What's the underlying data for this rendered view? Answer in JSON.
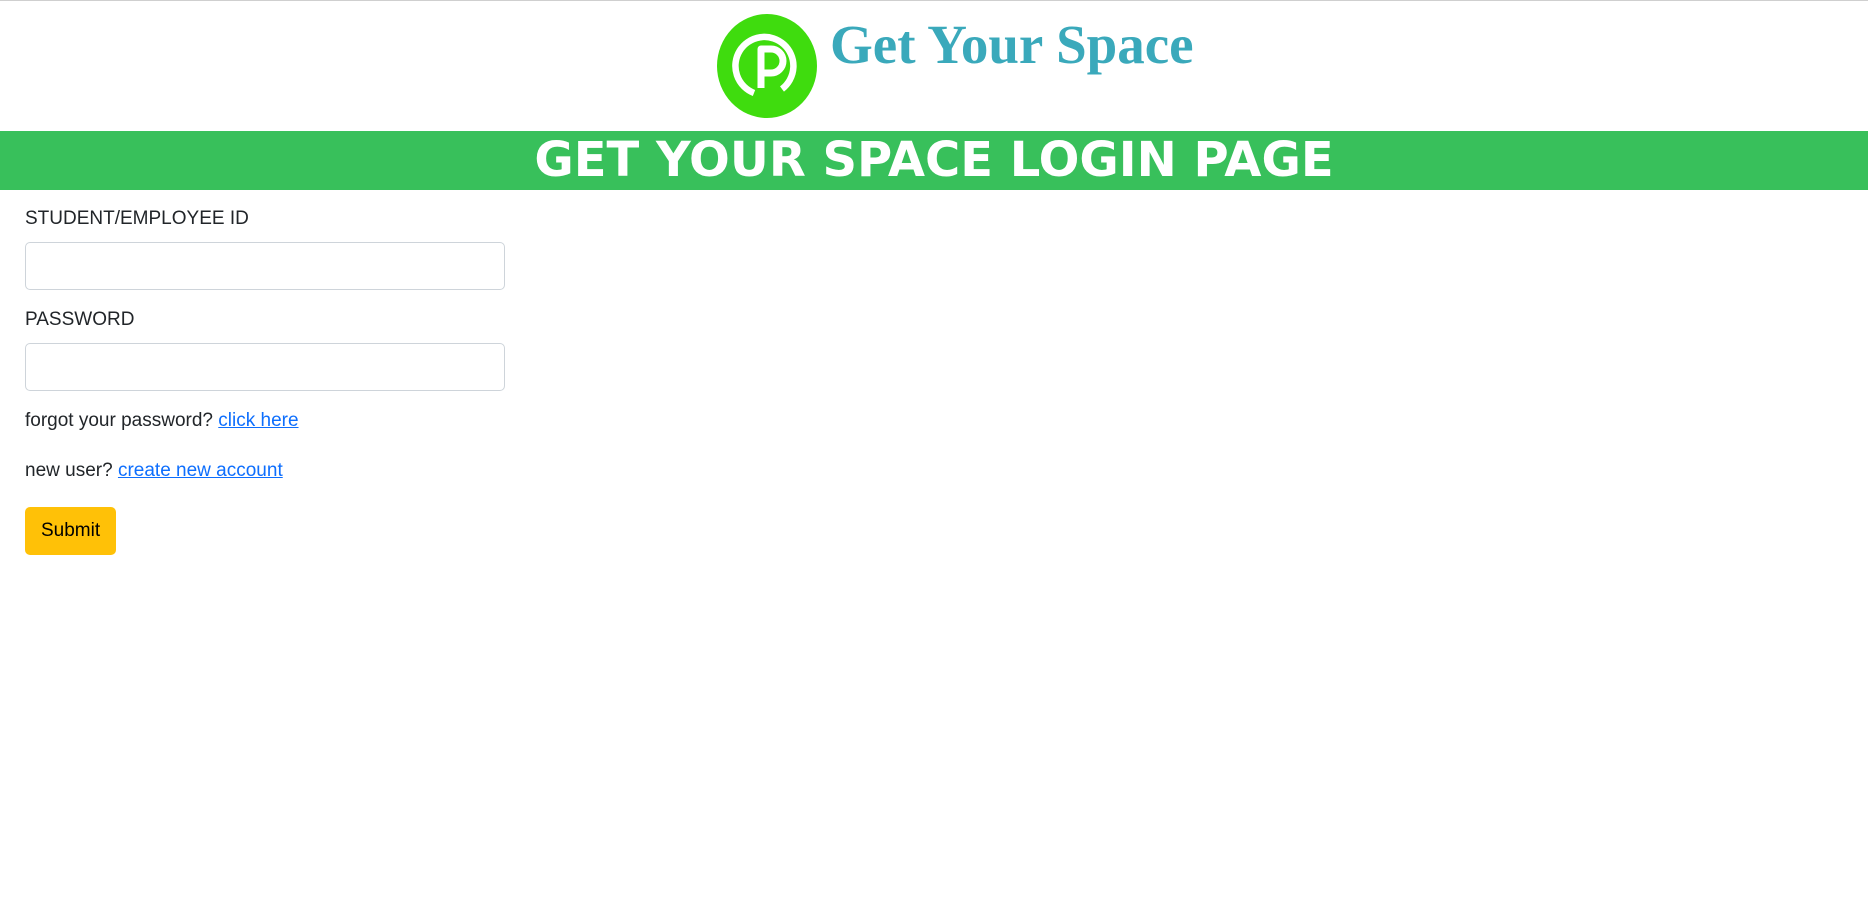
{
  "header": {
    "site_title": "Get Your Space",
    "logo_letter": "P"
  },
  "banner": {
    "title": "GET YOUR SPACE LOGIN PAGE"
  },
  "form": {
    "id_label": "STUDENT/EMPLOYEE ID",
    "id_value": "",
    "password_label": "PASSWORD",
    "password_value": "",
    "forgot_text": "forgot your password?",
    "forgot_link": "click here",
    "new_user_text": "new user?",
    "new_user_link": "create new account",
    "submit_label": "Submit"
  },
  "colors": {
    "brand_text": "#3aa9bb",
    "banner_bg": "#38c05b",
    "logo_green": "#3fdc0e",
    "link": "#0d6efd",
    "submit_bg": "#ffc107"
  }
}
